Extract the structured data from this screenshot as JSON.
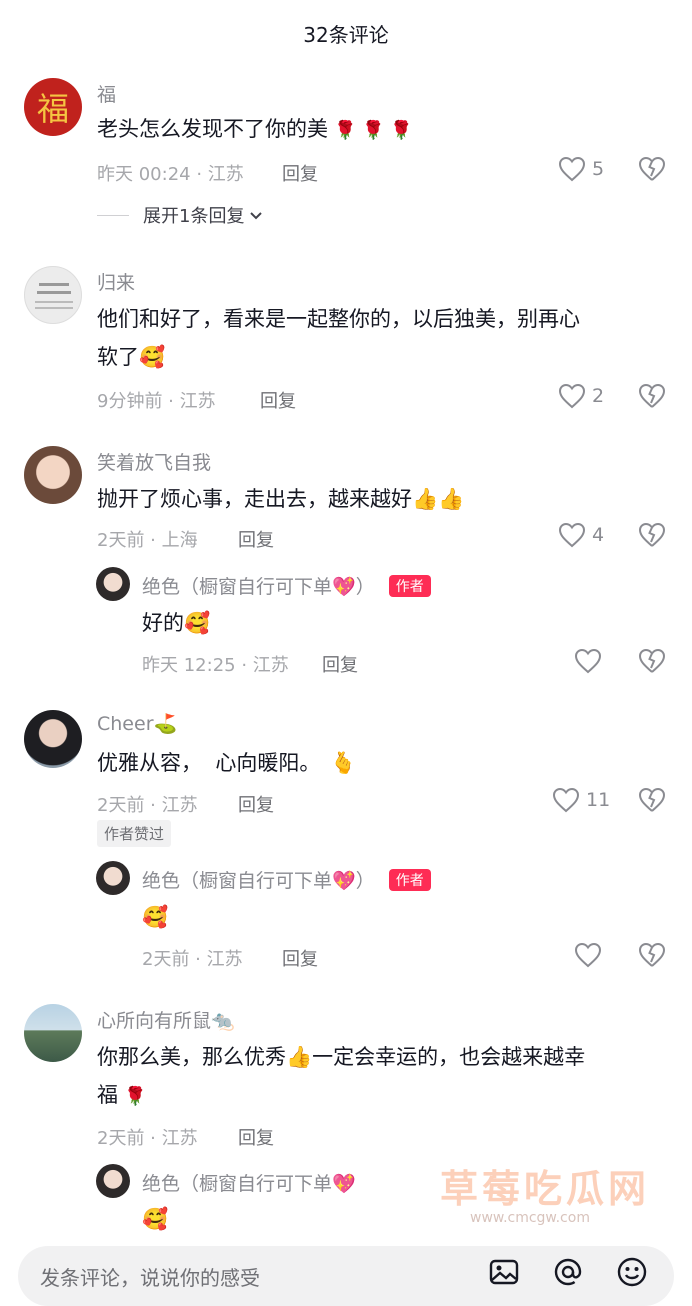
{
  "header": {
    "title": "32条评论"
  },
  "comments": [
    {
      "username": "福",
      "text": "老头怎么发现不了你的美",
      "emoji": "🌹 🌹 🌹",
      "time_location": "昨天 00:24 · 江苏",
      "reply_label": "回复",
      "likes": "5",
      "expand_label": "展开1条回复"
    },
    {
      "username": "归来",
      "text_line1": "他们和好了，看来是一起整你的，以后独美，别再心",
      "text_line2": "软了",
      "emoji": "🥰",
      "time_location": "9分钟前 · 江苏",
      "reply_label": "回复",
      "likes": "2"
    },
    {
      "username": "笑着放飞自我",
      "text": "抛开了烦心事，走出去，越来越好",
      "emoji": "👍👍",
      "time_location": "2天前 · 上海",
      "reply_label": "回复",
      "likes": "4",
      "reply": {
        "username": "绝色（橱窗自行可下单",
        "username_emoji": "💖",
        "username_close": "）",
        "author_tag": "作者",
        "text": "好的",
        "emoji": "🥰",
        "time_location": "昨天 12:25 · 江苏",
        "reply_label": "回复"
      }
    },
    {
      "username": "Cheer",
      "username_emoji": "⛳",
      "text": "优雅从容，  心向暖阳。",
      "emoji": "🫰",
      "time_location": "2天前 · 江苏",
      "reply_label": "回复",
      "likes": "11",
      "liked_badge": "作者赞过",
      "reply": {
        "username": "绝色（橱窗自行可下单",
        "username_emoji": "💖",
        "username_close": "）",
        "author_tag": "作者",
        "emoji": "🥰",
        "time_location": "2天前 · 江苏",
        "reply_label": "回复"
      }
    },
    {
      "username": "心所向有所鼠",
      "username_emoji": "🐀",
      "text_line1a": "你那么美，那么优秀",
      "text_line1_emoji": "👍",
      "text_line1b": "一定会幸运的，也会越来越幸",
      "text_line2": "福",
      "text_line2_emoji": "🌹",
      "time_location": "2天前 · 江苏",
      "reply_label": "回复",
      "reply": {
        "username": "绝色（橱窗自行可下单",
        "username_emoji": "💖",
        "emoji": "🥰"
      }
    }
  ],
  "watermark": {
    "text": "草莓吃瓜网",
    "url": "www.cmcgw.com"
  },
  "input_bar": {
    "placeholder": "发条评论，说说你的感受"
  },
  "colors": {
    "author_tag": "#fe2c55",
    "text": "#161823",
    "meta": "#a6a7ab"
  }
}
